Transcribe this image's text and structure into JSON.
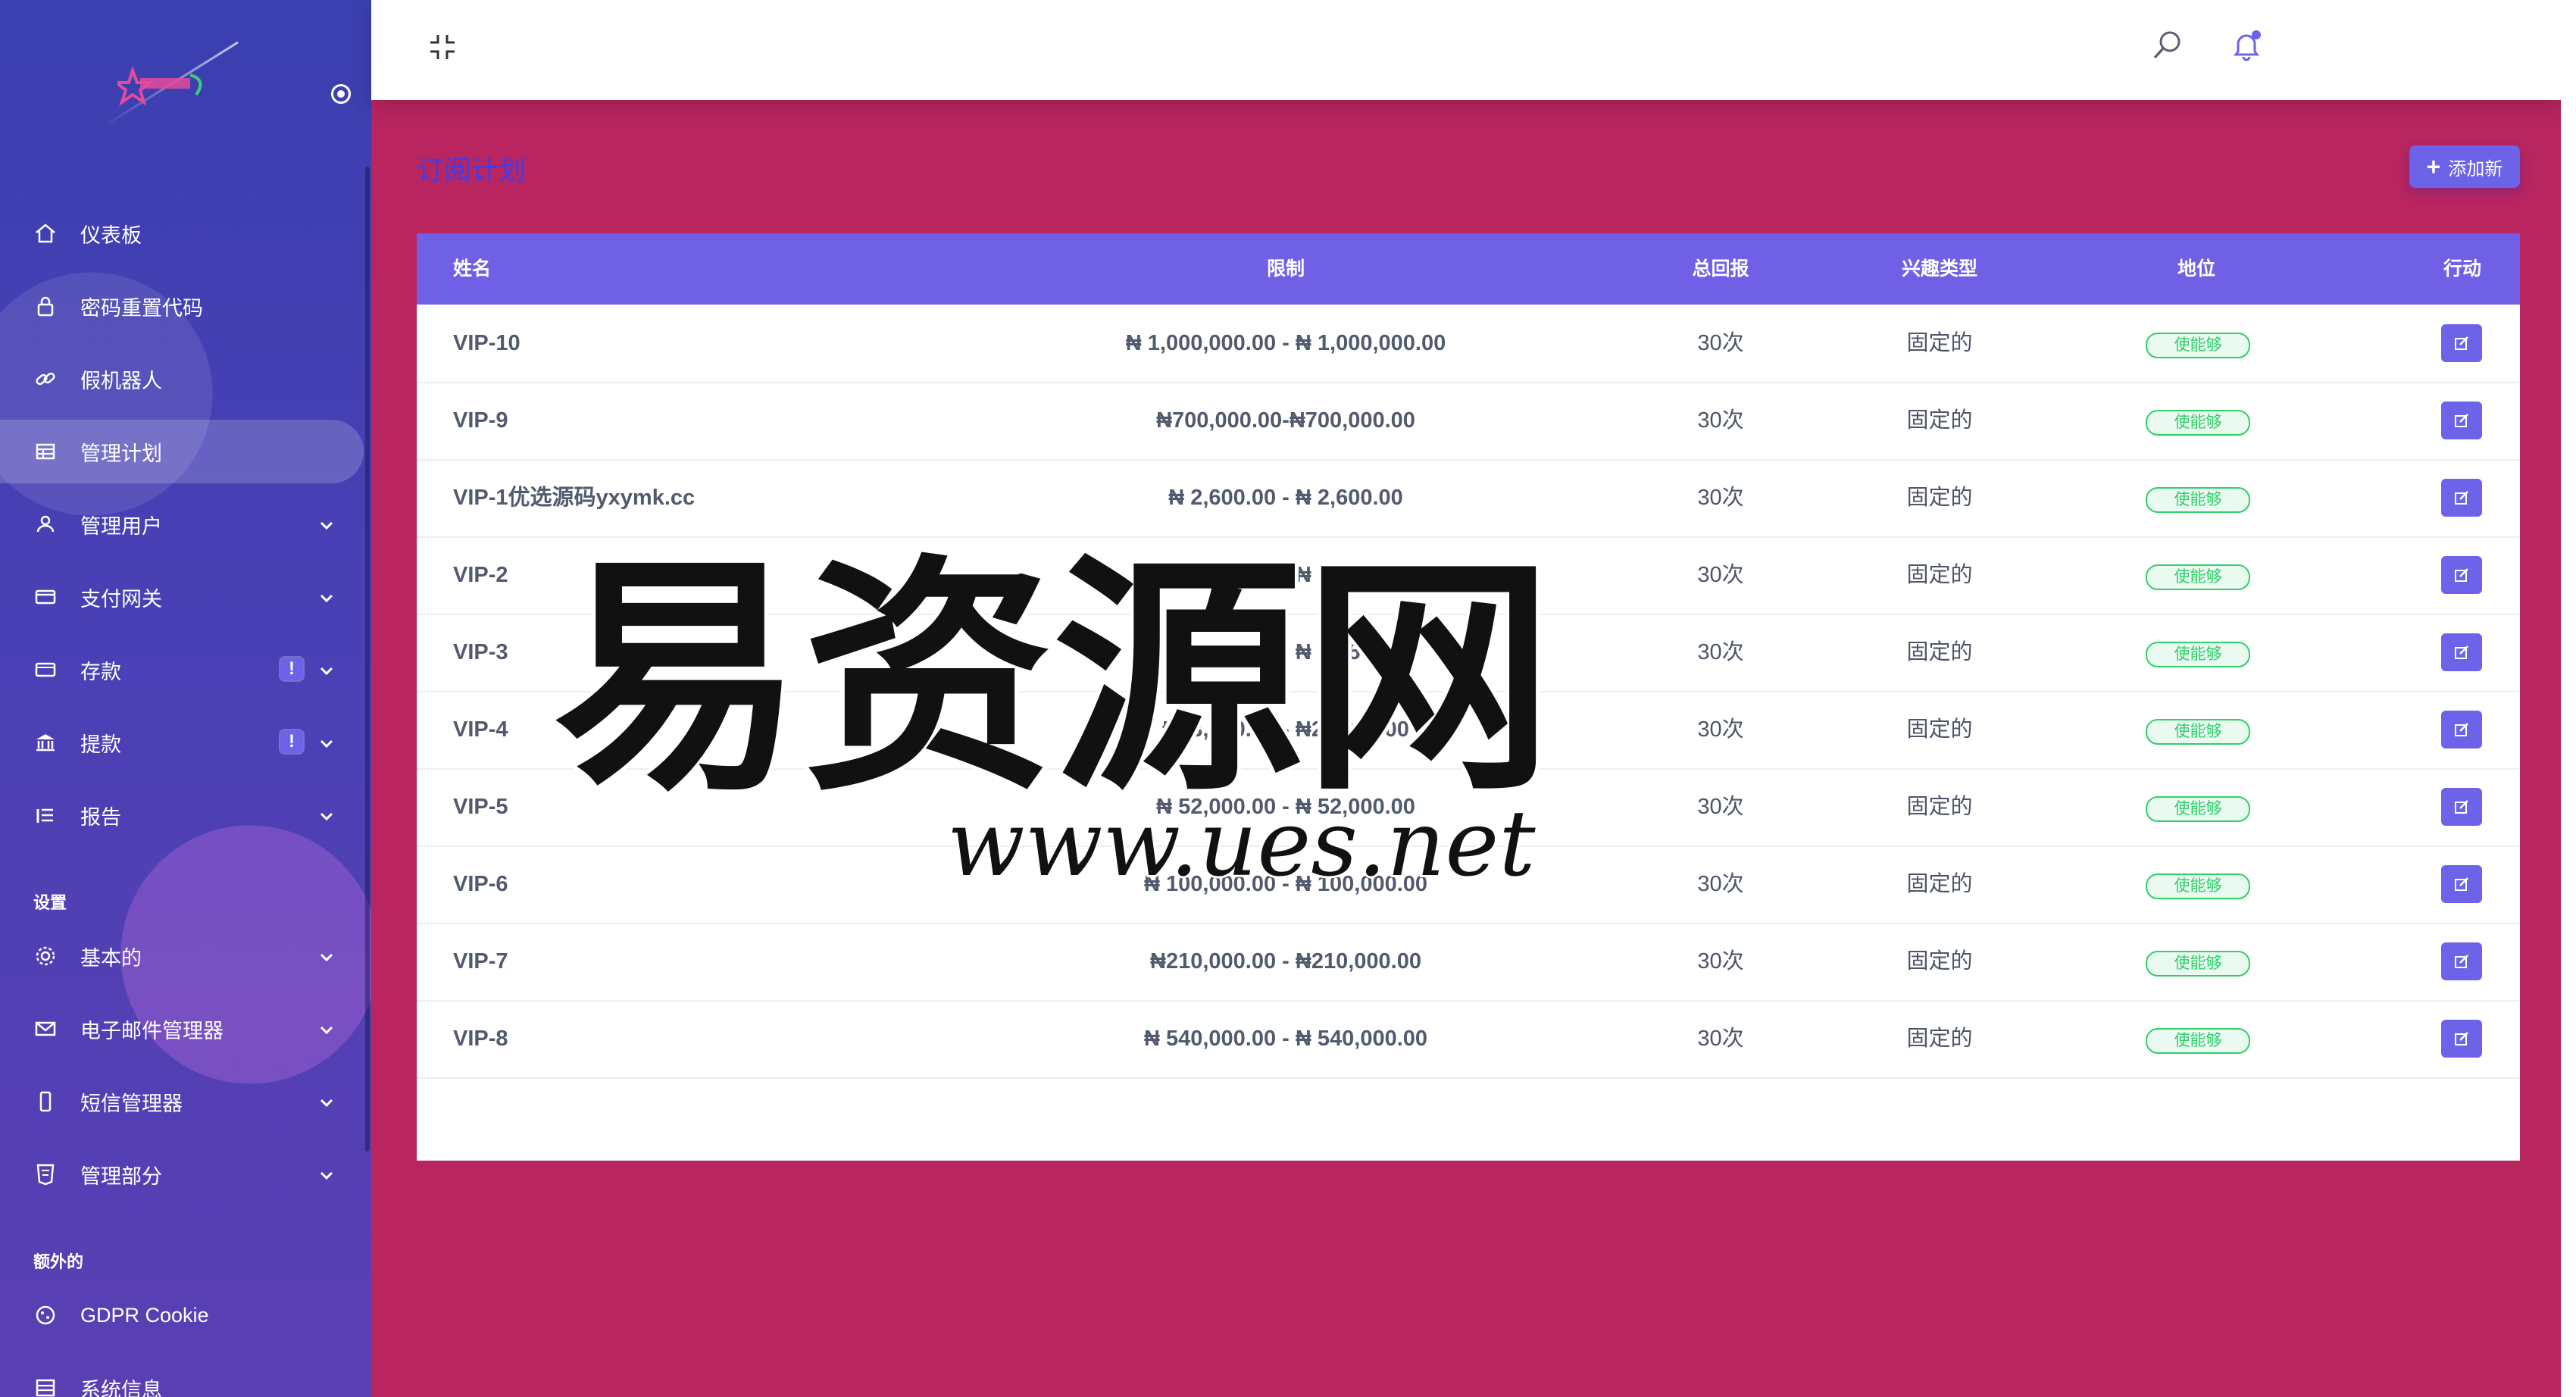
{
  "sidebar": {
    "items": [
      {
        "label": "仪表板",
        "icon": "home-icon"
      },
      {
        "label": "密码重置代码",
        "icon": "lock-icon"
      },
      {
        "label": "假机器人",
        "icon": "link-icon"
      },
      {
        "label": "管理计划",
        "icon": "table-icon"
      },
      {
        "label": "管理用户",
        "icon": "users-icon"
      },
      {
        "label": "支付网关",
        "icon": "credit-card-icon"
      },
      {
        "label": "存款",
        "icon": "wallet-icon",
        "badge": "!"
      },
      {
        "label": "提款",
        "icon": "bank-icon",
        "badge": "!"
      },
      {
        "label": "报告",
        "icon": "list-icon"
      }
    ],
    "section_settings": "设置",
    "settings_items": [
      {
        "label": "基本的",
        "icon": "gear-icon"
      },
      {
        "label": "电子邮件管理器",
        "icon": "envelope-icon"
      },
      {
        "label": "短信管理器",
        "icon": "phone-icon"
      },
      {
        "label": "管理部分",
        "icon": "html5-icon"
      }
    ],
    "section_extra": "额外的",
    "extra_items": [
      {
        "label": "GDPR Cookie",
        "icon": "cookie-icon"
      },
      {
        "label": "系统信息",
        "icon": "server-icon"
      }
    ]
  },
  "page": {
    "title": "订阅计划",
    "add_button": "添加新"
  },
  "table": {
    "headers": [
      "姓名",
      "限制",
      "总回报",
      "兴趣类型",
      "地位",
      "行动"
    ],
    "rows": [
      {
        "name": "VIP-10",
        "limit": "₦ 1,000,000.00 - ₦ 1,000,000.00",
        "return": "30次",
        "type": "固定的",
        "status": "使能够"
      },
      {
        "name": "VIP-9",
        "limit": "₦700,000.00-₦700,000.00",
        "return": "30次",
        "type": "固定的",
        "status": "使能够"
      },
      {
        "name": "VIP-1优选源码yxymk.cc",
        "limit": "₦ 2,600.00 - ₦ 2,600.00",
        "return": "30次",
        "type": "固定的",
        "status": "使能够"
      },
      {
        "name": "VIP-2",
        "limit": "₦ 5,100.00 - ₦ 5,100.00",
        "return": "30次",
        "type": "固定的",
        "status": "使能够"
      },
      {
        "name": "VIP-3",
        "limit": "₦ 10,500.00 - ₦ 10,500.00",
        "return": "30次",
        "type": "固定的",
        "status": "使能够"
      },
      {
        "name": "VIP-4",
        "limit": "₦23,000.00 - ₦23,000.00",
        "return": "30次",
        "type": "固定的",
        "status": "使能够"
      },
      {
        "name": "VIP-5",
        "limit": "₦ 52,000.00 - ₦ 52,000.00",
        "return": "30次",
        "type": "固定的",
        "status": "使能够"
      },
      {
        "name": "VIP-6",
        "limit": "₦ 100,000.00 - ₦ 100,000.00",
        "return": "30次",
        "type": "固定的",
        "status": "使能够"
      },
      {
        "name": "VIP-7",
        "limit": "₦210,000.00 - ₦210,000.00",
        "return": "30次",
        "type": "固定的",
        "status": "使能够"
      },
      {
        "name": "VIP-8",
        "limit": "₦ 540,000.00 - ₦ 540,000.00",
        "return": "30次",
        "type": "固定的",
        "status": "使能够"
      }
    ]
  },
  "watermark": {
    "main": "易资源网",
    "url": "www.ues.net"
  },
  "colors": {
    "accent": "#6c63e8",
    "background": "#b9255f",
    "title": "#3d3df0",
    "status": "#2fcf6a"
  }
}
